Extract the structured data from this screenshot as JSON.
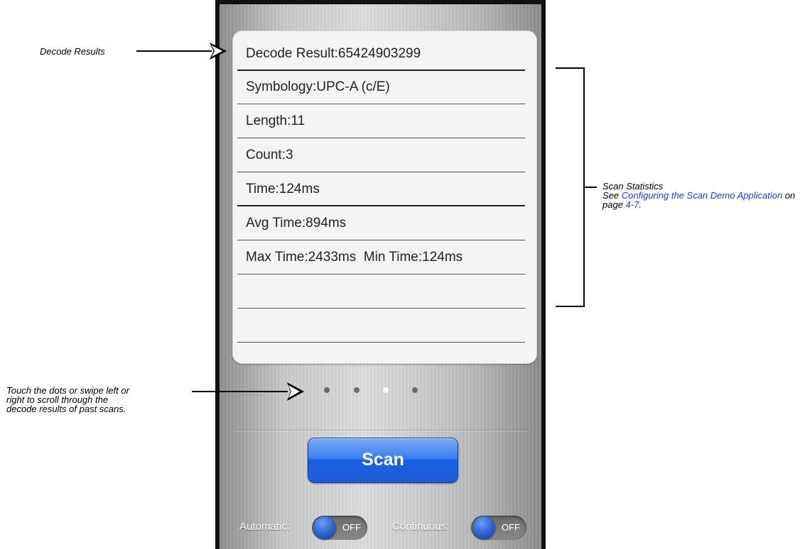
{
  "decode": {
    "result_label": "Decode Result:",
    "result_value": "65424903299"
  },
  "stats": [
    {
      "label": "Symbology:",
      "value": "UPC-A (c/E)"
    },
    {
      "label": "Length:",
      "value": "11"
    },
    {
      "label": "Count:",
      "value": "3"
    },
    {
      "label": "Time:",
      "value": "124ms"
    },
    {
      "label": "Avg Time:",
      "value": "894ms"
    },
    {
      "label": "Max Time:",
      "value": "2433ms"
    },
    {
      "label": "Min Time:",
      "value": "124ms"
    }
  ],
  "pager": {
    "count": 4,
    "active_index": 2
  },
  "buttons": {
    "scan_label": "Scan"
  },
  "toggles": {
    "automatic": {
      "label": "Automatic:",
      "state": "OFF"
    },
    "continuous": {
      "label": "Continuous:",
      "state": "OFF"
    }
  },
  "annotations": {
    "decode_results": "Decode Results",
    "scan_stats_title": "Scan Statistics",
    "scan_stats_see": "See ",
    "scan_stats_link": "Configuring the Scan Demo Application",
    "scan_stats_on_page": " on page ",
    "scan_stats_page_link": "4-7",
    "scan_stats_period": ".",
    "dots_line1": "Touch the dots or swipe left or",
    "dots_line2": "right to scroll through the",
    "dots_line3": "decode results of past scans."
  },
  "colors": {
    "scan_button": "#1a5fe0",
    "link": "#1a3cd6",
    "toggle_knob": "#2a5fd2"
  }
}
